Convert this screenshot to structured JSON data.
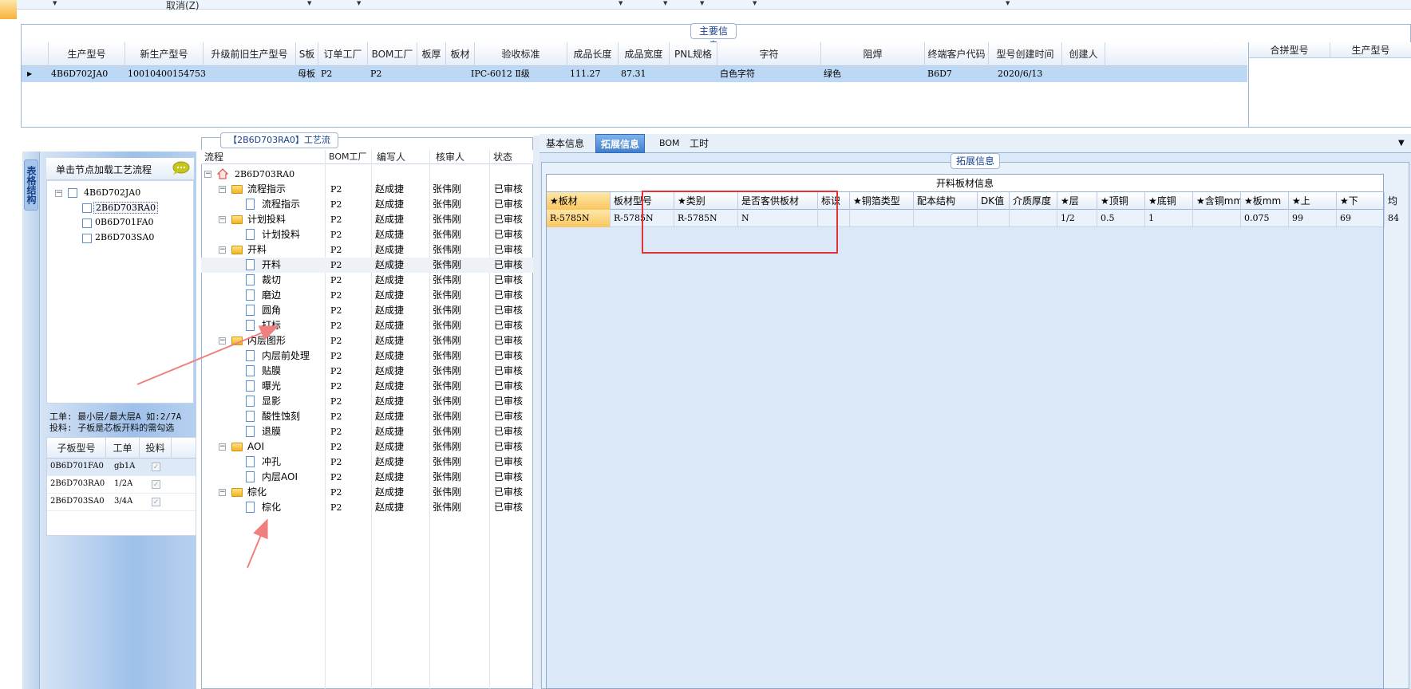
{
  "toolbar": {
    "cancel_label": "取消(Z)"
  },
  "main_info": {
    "title": "主要信息",
    "columns": [
      "生产型号",
      "新生产型号",
      "升级前旧生产型号",
      "S板",
      "订单工厂",
      "BOM工厂",
      "板厚",
      "板材",
      "验收标准",
      "成品长度",
      "成品宽度",
      "PNL规格",
      "字符",
      "阻焊",
      "终端客户代码",
      "型号创建时间",
      "创建人"
    ],
    "row": [
      "4B6D702JA0",
      "10010400154753",
      "",
      "母板",
      "P2",
      "P2",
      "",
      "",
      "IPC-6012 Ⅱ级",
      "111.27",
      "87.31",
      "",
      "白色字符",
      "绿色",
      "B6D7",
      "2020/6/13",
      ""
    ],
    "combine_columns": [
      "合拼型号",
      "生产型号"
    ]
  },
  "left": {
    "vtab_label": "表格结构",
    "hint": "单击节点加载工艺流程",
    "tree_root": "4B6D702JA0",
    "tree_children": [
      "2B6D703RA0",
      "0B6D701FA0",
      "2B6D703SA0"
    ],
    "note_line1": "工单: 最小层/最大层A 如:2/7A",
    "note_line2": "投料: 子板是芯板开料的需勾选",
    "sub_columns": [
      "子板型号",
      "工单",
      "投料"
    ],
    "sub_rows": [
      {
        "model": "0B6D701FA0",
        "order": "gb1A"
      },
      {
        "model": "2B6D703RA0",
        "order": "1/2A"
      },
      {
        "model": "2B6D703SA0",
        "order": "3/4A"
      }
    ]
  },
  "flow": {
    "title": "【2B6D703RA0】工艺流程",
    "columns": [
      "流程",
      "BOM工厂",
      "编写人",
      "核审人",
      "状态"
    ],
    "root": "2B6D703RA0",
    "rows": [
      {
        "name": "流程指示",
        "folder": true,
        "bom": "P2",
        "writer": "赵成捷",
        "reviewer": "张伟刚",
        "status": "已审核"
      },
      {
        "name": "流程指示",
        "folder": false,
        "bom": "P2",
        "writer": "赵成捷",
        "reviewer": "张伟刚",
        "status": "已审核"
      },
      {
        "name": "计划投料",
        "folder": true,
        "bom": "P2",
        "writer": "赵成捷",
        "reviewer": "张伟刚",
        "status": "已审核"
      },
      {
        "name": "计划投料",
        "folder": false,
        "bom": "P2",
        "writer": "赵成捷",
        "reviewer": "张伟刚",
        "status": "已审核"
      },
      {
        "name": "开料",
        "folder": true,
        "bom": "P2",
        "writer": "赵成捷",
        "reviewer": "张伟刚",
        "status": "已审核"
      },
      {
        "name": "开料",
        "folder": false,
        "bom": "P2",
        "writer": "赵成捷",
        "reviewer": "张伟刚",
        "status": "已审核"
      },
      {
        "name": "裁切",
        "folder": false,
        "bom": "P2",
        "writer": "赵成捷",
        "reviewer": "张伟刚",
        "status": "已审核"
      },
      {
        "name": "磨边",
        "folder": false,
        "bom": "P2",
        "writer": "赵成捷",
        "reviewer": "张伟刚",
        "status": "已审核"
      },
      {
        "name": "圆角",
        "folder": false,
        "bom": "P2",
        "writer": "赵成捷",
        "reviewer": "张伟刚",
        "status": "已审核"
      },
      {
        "name": "打标",
        "folder": false,
        "bom": "P2",
        "writer": "赵成捷",
        "reviewer": "张伟刚",
        "status": "已审核"
      },
      {
        "name": "内层图形",
        "folder": true,
        "bom": "P2",
        "writer": "赵成捷",
        "reviewer": "张伟刚",
        "status": "已审核"
      },
      {
        "name": "内层前处理",
        "folder": false,
        "bom": "P2",
        "writer": "赵成捷",
        "reviewer": "张伟刚",
        "status": "已审核"
      },
      {
        "name": "贴膜",
        "folder": false,
        "bom": "P2",
        "writer": "赵成捷",
        "reviewer": "张伟刚",
        "status": "已审核"
      },
      {
        "name": "曝光",
        "folder": false,
        "bom": "P2",
        "writer": "赵成捷",
        "reviewer": "张伟刚",
        "status": "已审核"
      },
      {
        "name": "显影",
        "folder": false,
        "bom": "P2",
        "writer": "赵成捷",
        "reviewer": "张伟刚",
        "status": "已审核"
      },
      {
        "name": "酸性蚀刻",
        "folder": false,
        "bom": "P2",
        "writer": "赵成捷",
        "reviewer": "张伟刚",
        "status": "已审核"
      },
      {
        "name": "退膜",
        "folder": false,
        "bom": "P2",
        "writer": "赵成捷",
        "reviewer": "张伟刚",
        "status": "已审核"
      },
      {
        "name": "AOI",
        "folder": true,
        "bom": "P2",
        "writer": "赵成捷",
        "reviewer": "张伟刚",
        "status": "已审核"
      },
      {
        "name": "冲孔",
        "folder": false,
        "bom": "P2",
        "writer": "赵成捷",
        "reviewer": "张伟刚",
        "status": "已审核"
      },
      {
        "name": "内层AOI",
        "folder": false,
        "bom": "P2",
        "writer": "赵成捷",
        "reviewer": "张伟刚",
        "status": "已审核"
      },
      {
        "name": "棕化",
        "folder": true,
        "bom": "P2",
        "writer": "赵成捷",
        "reviewer": "张伟刚",
        "status": "已审核"
      },
      {
        "name": "棕化",
        "folder": false,
        "bom": "P2",
        "writer": "赵成捷",
        "reviewer": "张伟刚",
        "status": "已审核"
      }
    ]
  },
  "right": {
    "tabs": [
      "基本信息",
      "拓展信息",
      "BOM",
      "工时"
    ],
    "active_tab": 1,
    "group_title": "拓展信息",
    "sheet_title": "开料板材信息",
    "columns": [
      "★板材",
      "板材型号",
      "★类别",
      "是否客供板材",
      "标识",
      "★铜箔类型",
      "配本结构",
      "DK值",
      "介质厚度",
      "★层",
      "★顶铜",
      "★底铜",
      "★含铜mm",
      "★板mm",
      "★上",
      "★下",
      "均"
    ],
    "row": [
      "R-5785N",
      "R-5785N",
      "R-5785N",
      "N",
      "",
      "",
      "",
      "",
      "",
      "1/2",
      "0.5",
      "1",
      "",
      "0.075",
      "99",
      "69",
      "84"
    ]
  },
  "colors": {
    "annotation_red": "#e0343a",
    "selected_row": "#bcd8f5",
    "accent_blue": "#3f7fcf"
  }
}
